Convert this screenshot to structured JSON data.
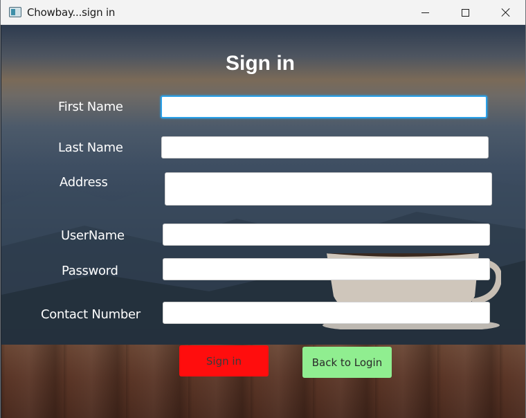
{
  "window": {
    "title": "Chowbay...sign in",
    "controls": {
      "minimize_icon": "minimize-icon",
      "maximize_icon": "maximize-icon",
      "close_icon": "close-icon"
    }
  },
  "form": {
    "heading": "Sign in",
    "fields": [
      {
        "label": "First Name",
        "value": "",
        "focused": true
      },
      {
        "label": "Last Name",
        "value": ""
      },
      {
        "label": "Address",
        "value": ""
      },
      {
        "label": "UserName",
        "value": ""
      },
      {
        "label": "Password",
        "value": ""
      },
      {
        "label": "Contact Number",
        "value": ""
      }
    ],
    "buttons": {
      "signin_label": "Sign in",
      "back_label": "Back to Login"
    }
  },
  "colors": {
    "signin_button": "#ff0d0d",
    "back_button": "#90ee90",
    "focus_ring": "#2aa0e8"
  }
}
